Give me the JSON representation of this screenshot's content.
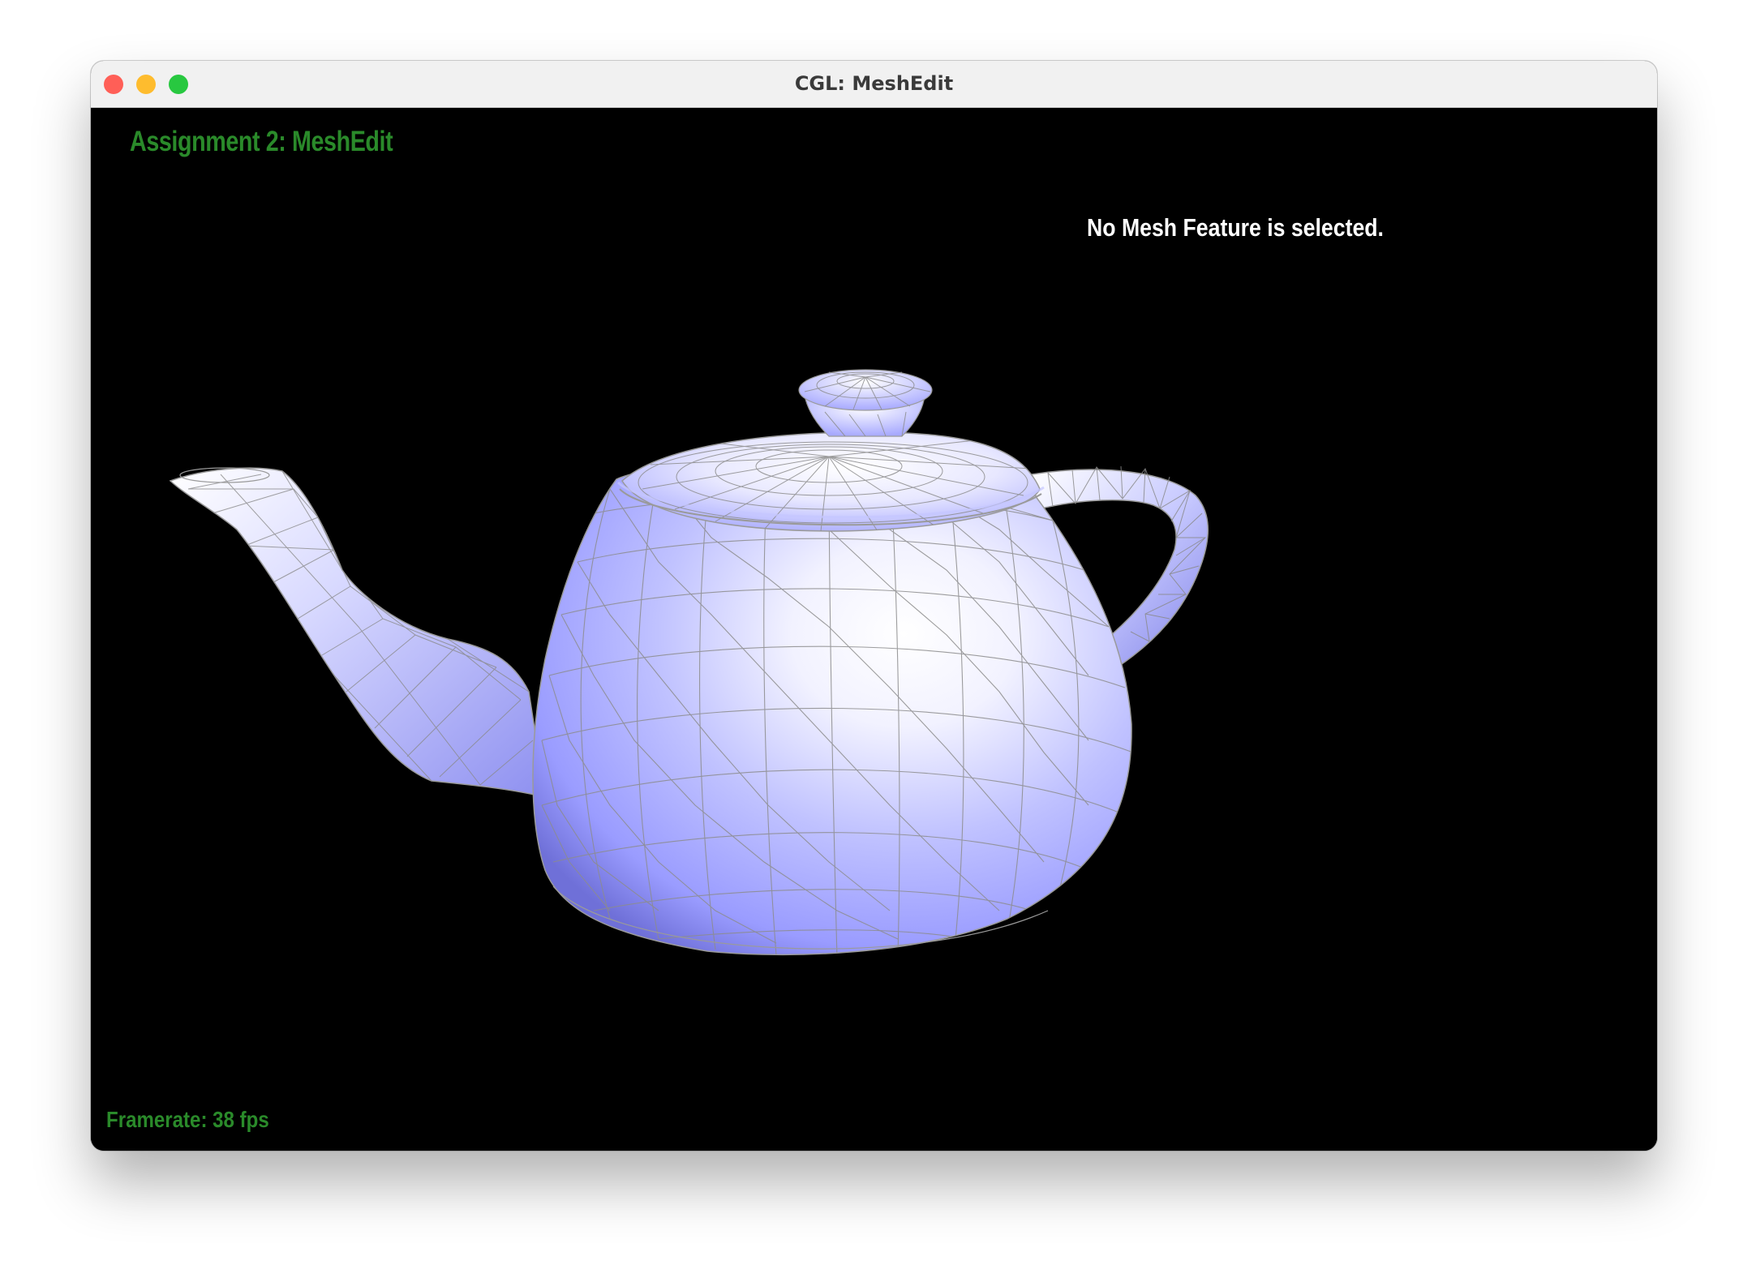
{
  "window": {
    "title": "CGL: MeshEdit",
    "controls": {
      "close_color": "#ff5f57",
      "minimize_color": "#febc2e",
      "zoom_color": "#28c840"
    }
  },
  "viewport": {
    "background": "#000000",
    "hud": {
      "assignment_title": "Assignment 2: MeshEdit",
      "selection_status": "No Mesh Feature is selected.",
      "framerate": "Framerate: 38 fps",
      "hud_color": "#2a8a2a"
    },
    "model": {
      "name": "teapot-mesh",
      "shading": "smooth",
      "wireframe": true,
      "base_color": "#9a9cff",
      "highlight_color": "#ffffff",
      "edge_color": "#8a8a8a"
    }
  }
}
